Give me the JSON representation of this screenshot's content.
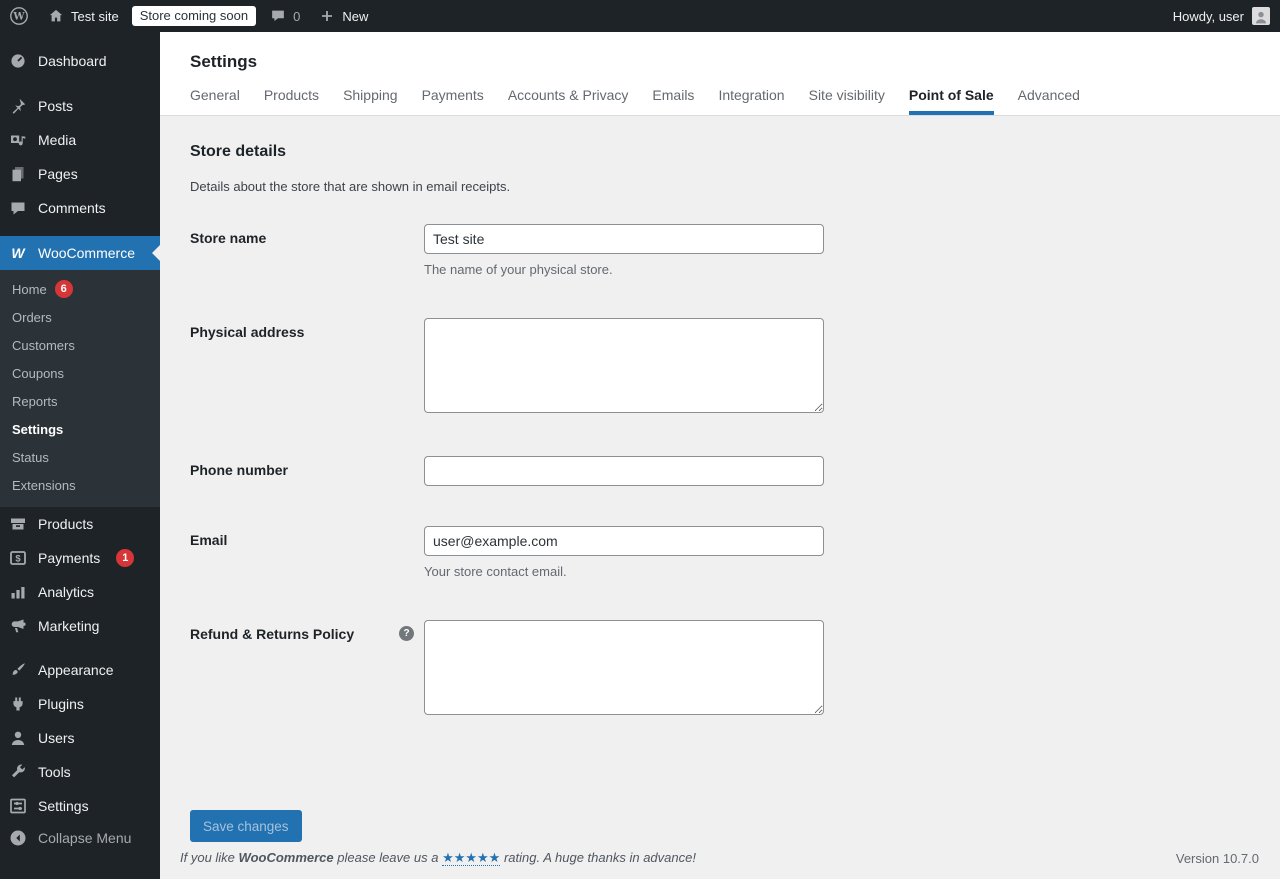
{
  "admin_bar": {
    "site_name": "Test site",
    "coming_soon": "Store coming soon",
    "comment_count": "0",
    "new_label": "New",
    "howdy": "Howdy, user"
  },
  "sidebar": {
    "items": [
      {
        "label": "Dashboard"
      },
      {
        "label": "Posts"
      },
      {
        "label": "Media"
      },
      {
        "label": "Pages"
      },
      {
        "label": "Comments"
      },
      {
        "label": "WooCommerce"
      },
      {
        "label": "Products"
      },
      {
        "label": "Payments",
        "badge": "1"
      },
      {
        "label": "Analytics"
      },
      {
        "label": "Marketing"
      },
      {
        "label": "Appearance"
      },
      {
        "label": "Plugins"
      },
      {
        "label": "Users"
      },
      {
        "label": "Tools"
      },
      {
        "label": "Settings"
      },
      {
        "label": "Collapse Menu"
      }
    ],
    "woocommerce_submenu": [
      {
        "label": "Home",
        "badge": "6"
      },
      {
        "label": "Orders"
      },
      {
        "label": "Customers"
      },
      {
        "label": "Coupons"
      },
      {
        "label": "Reports"
      },
      {
        "label": "Settings",
        "current": true
      },
      {
        "label": "Status"
      },
      {
        "label": "Extensions"
      }
    ]
  },
  "page": {
    "title": "Settings",
    "tabs": [
      {
        "label": "General"
      },
      {
        "label": "Products"
      },
      {
        "label": "Shipping"
      },
      {
        "label": "Payments"
      },
      {
        "label": "Accounts & Privacy"
      },
      {
        "label": "Emails"
      },
      {
        "label": "Integration"
      },
      {
        "label": "Site visibility"
      },
      {
        "label": "Point of Sale",
        "active": true
      },
      {
        "label": "Advanced"
      }
    ]
  },
  "store_details": {
    "heading": "Store details",
    "description": "Details about the store that are shown in email receipts.",
    "fields": {
      "store_name": {
        "label": "Store name",
        "value": "Test site",
        "help": "The name of your physical store."
      },
      "physical_address": {
        "label": "Physical address",
        "value": ""
      },
      "phone_number": {
        "label": "Phone number",
        "value": ""
      },
      "email": {
        "label": "Email",
        "value": "user@example.com",
        "help": "Your store contact email."
      },
      "refund_policy": {
        "label": "Refund & Returns Policy",
        "value": ""
      }
    },
    "save_button": "Save changes"
  },
  "footer": {
    "like_prefix": "If you like ",
    "brand": "WooCommerce",
    "like_middle": " please leave us a ",
    "stars": "★★★★★",
    "like_suffix": " rating. A huge thanks in advance!",
    "version": "Version 10.7.0"
  },
  "colors": {
    "accent_blue": "#2271b1",
    "badge_red": "#d63638",
    "admin_bar_bg": "#1d2327",
    "submenu_bg": "#2c3338",
    "content_bg": "#f0f0f1"
  }
}
